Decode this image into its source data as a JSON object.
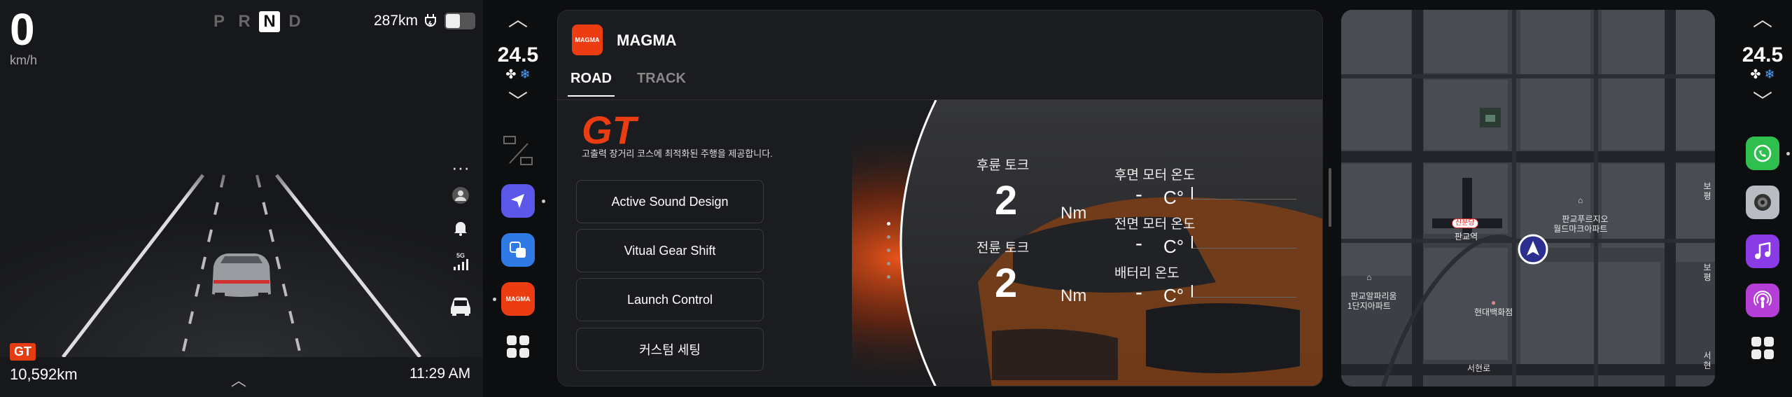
{
  "cluster": {
    "speed": "0",
    "speed_unit": "km/h",
    "gears": [
      "P",
      "R",
      "N",
      "D"
    ],
    "active_gear": "N",
    "range": "287km",
    "mode_badge": "GT",
    "odometer": "10,592km",
    "time": "11:29 AM",
    "signal_label": "5G"
  },
  "climate_left": {
    "temp": "24.5"
  },
  "climate_right": {
    "temp": "24.5"
  },
  "magma": {
    "logo_text": "MAGMA",
    "title": "MAGMA",
    "tabs": [
      "ROAD",
      "TRACK"
    ],
    "active_tab": "ROAD",
    "mode_title": "GT",
    "mode_desc": "고출력 장거리 코스에 최적화된 주행을 제공합니다.",
    "buttons": [
      "Active Sound Design",
      "Vitual Gear Shift",
      "Launch Control",
      "커스텀 세팅"
    ],
    "stats": [
      {
        "label": "후륜 토크",
        "value": "2",
        "unit": "Nm"
      },
      {
        "label": "전륜 토크",
        "value": "2",
        "unit": "Nm"
      }
    ],
    "temps": [
      {
        "label": "후면 모터 온도",
        "value": "-",
        "unit": "C°"
      },
      {
        "label": "전면 모터 온도",
        "value": "-",
        "unit": "C°"
      },
      {
        "label": "배터리 온도",
        "value": "-",
        "unit": "C°"
      }
    ]
  },
  "map": {
    "labels": {
      "station": "신분당",
      "gangnam": "판교역",
      "alpha_dome": "판교알파리움\n1단지아파트",
      "hyundai": "현대백화점",
      "doosan": "판교푸르지오\n월드마크아파트",
      "seohyeon": "서현로",
      "seohyeon_right": "서현",
      "bo1": "보평",
      "bo2": "보평"
    }
  },
  "colors": {
    "accent": "#ec3d12",
    "nav_blue": "#2b2f8f",
    "fan_blue": "#4aa3ff"
  }
}
